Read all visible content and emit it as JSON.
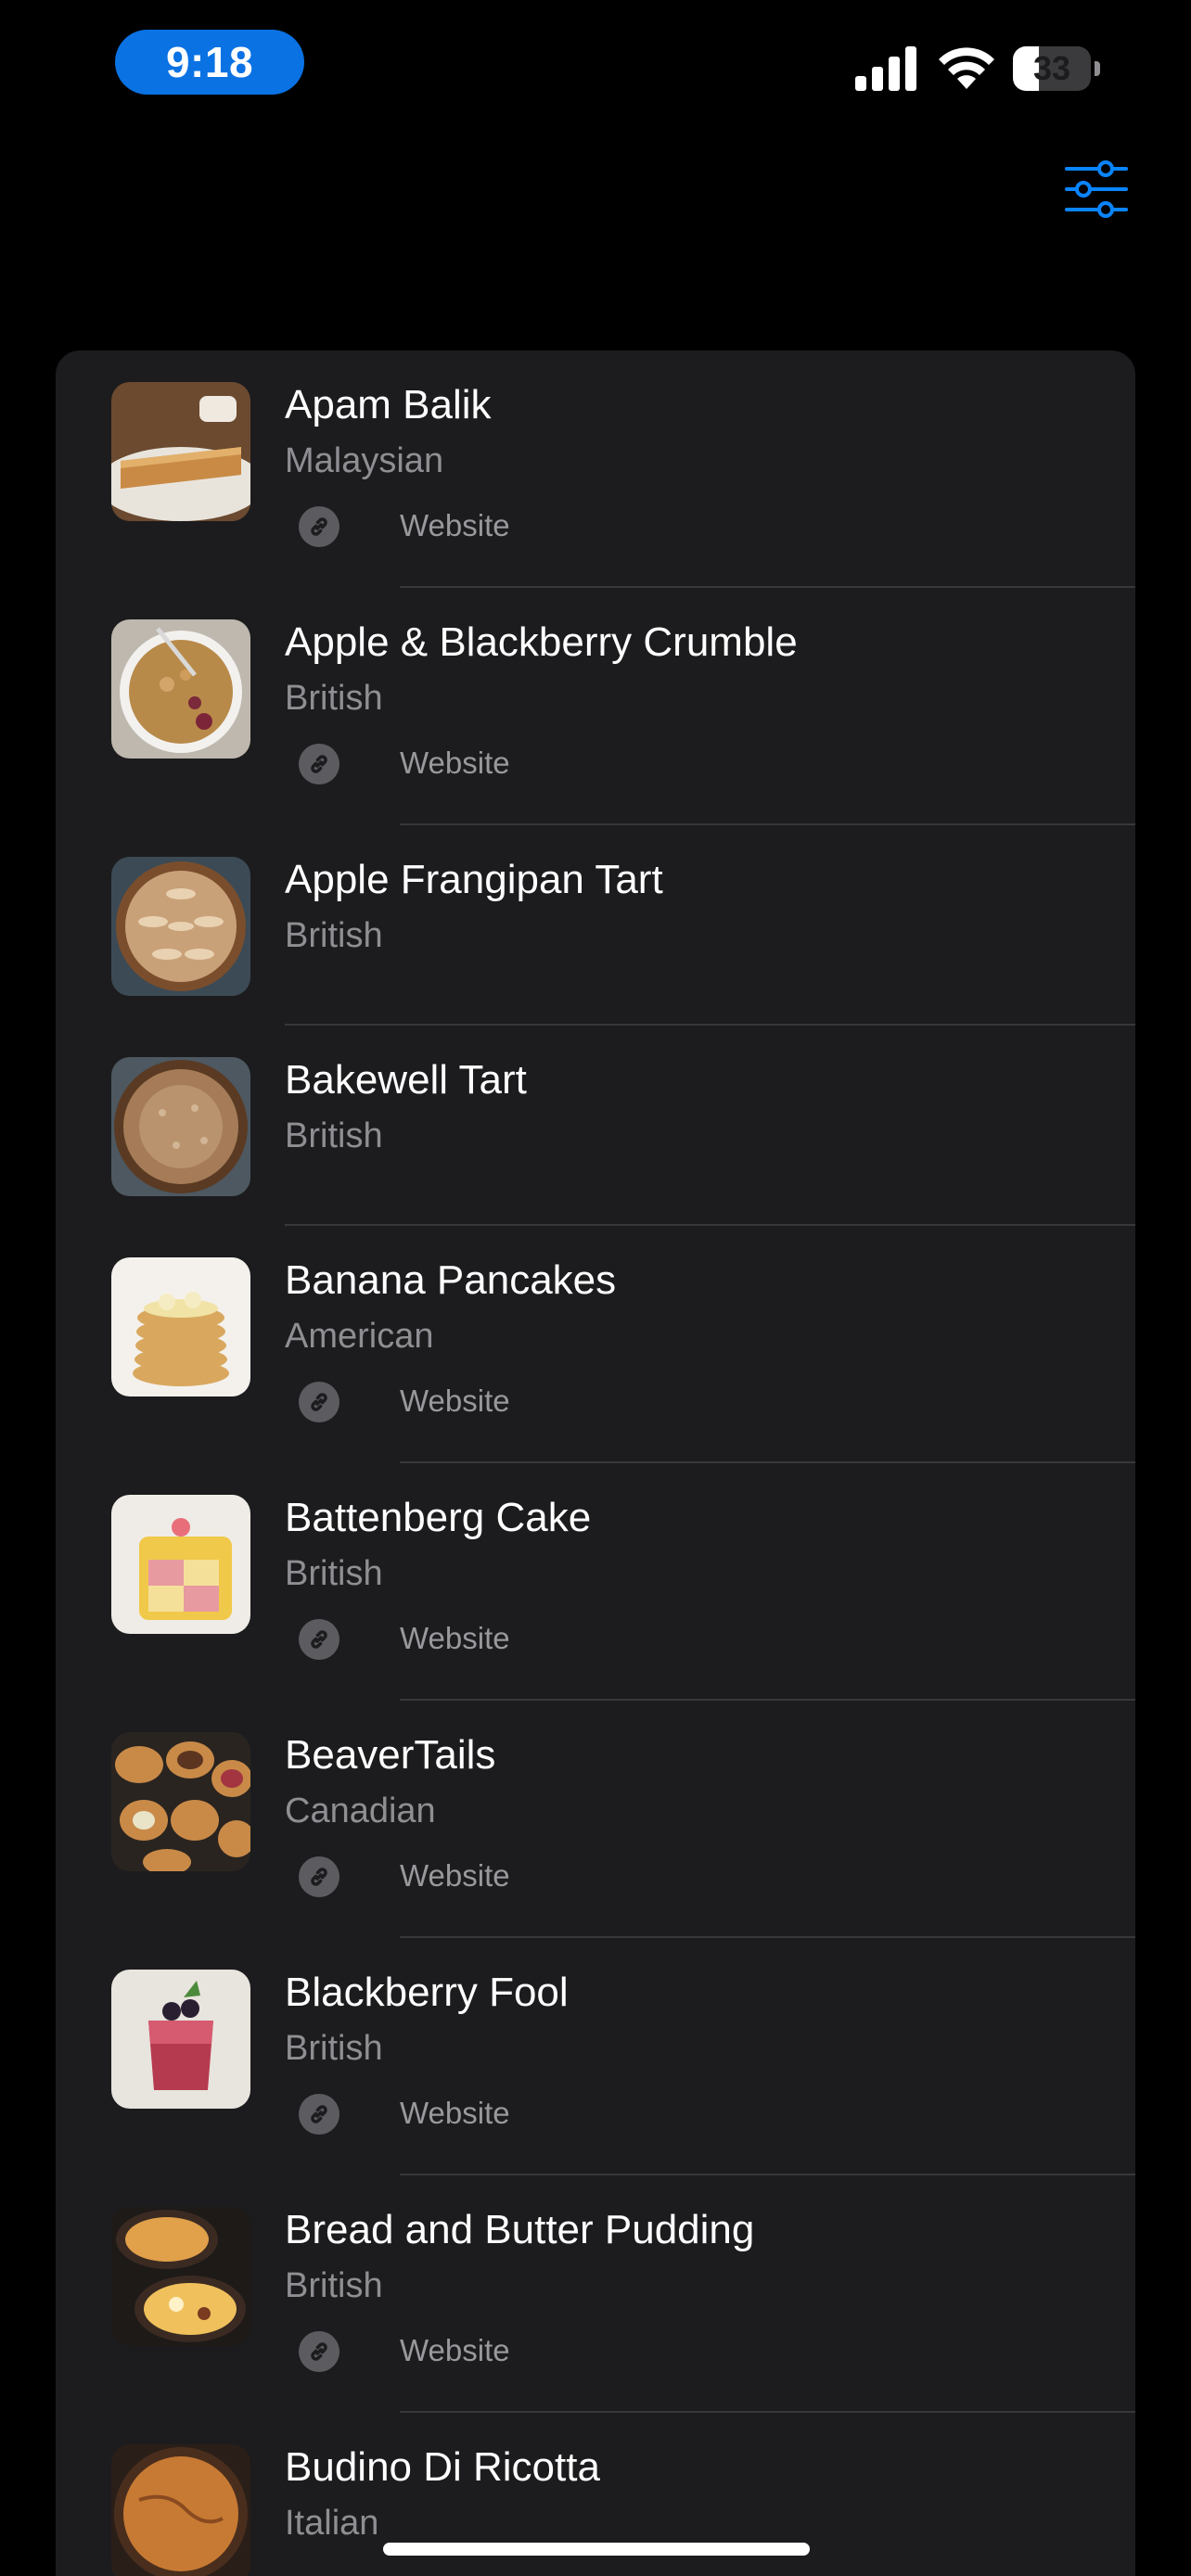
{
  "status_bar": {
    "time": "9:18",
    "battery_level": "33",
    "battery_fraction": 0.33
  },
  "toolbar": {
    "filter_icon": "sliders-icon",
    "accent_color": "#0a84ff"
  },
  "recipes": [
    {
      "name": "Apam Balik",
      "cuisine": "Malaysian",
      "link_label": "Website"
    },
    {
      "name": "Apple & Blackberry Crumble",
      "cuisine": "British",
      "link_label": "Website"
    },
    {
      "name": "Apple Frangipan Tart",
      "cuisine": "British"
    },
    {
      "name": "Bakewell Tart",
      "cuisine": "British"
    },
    {
      "name": "Banana Pancakes",
      "cuisine": "American",
      "link_label": "Website"
    },
    {
      "name": "Battenberg Cake",
      "cuisine": "British",
      "link_label": "Website"
    },
    {
      "name": "BeaverTails",
      "cuisine": "Canadian",
      "link_label": "Website"
    },
    {
      "name": "Blackberry Fool",
      "cuisine": "British",
      "link_label": "Website"
    },
    {
      "name": "Bread and Butter Pudding",
      "cuisine": "British",
      "link_label": "Website"
    },
    {
      "name": "Budino Di Ricotta",
      "cuisine": "Italian"
    }
  ]
}
